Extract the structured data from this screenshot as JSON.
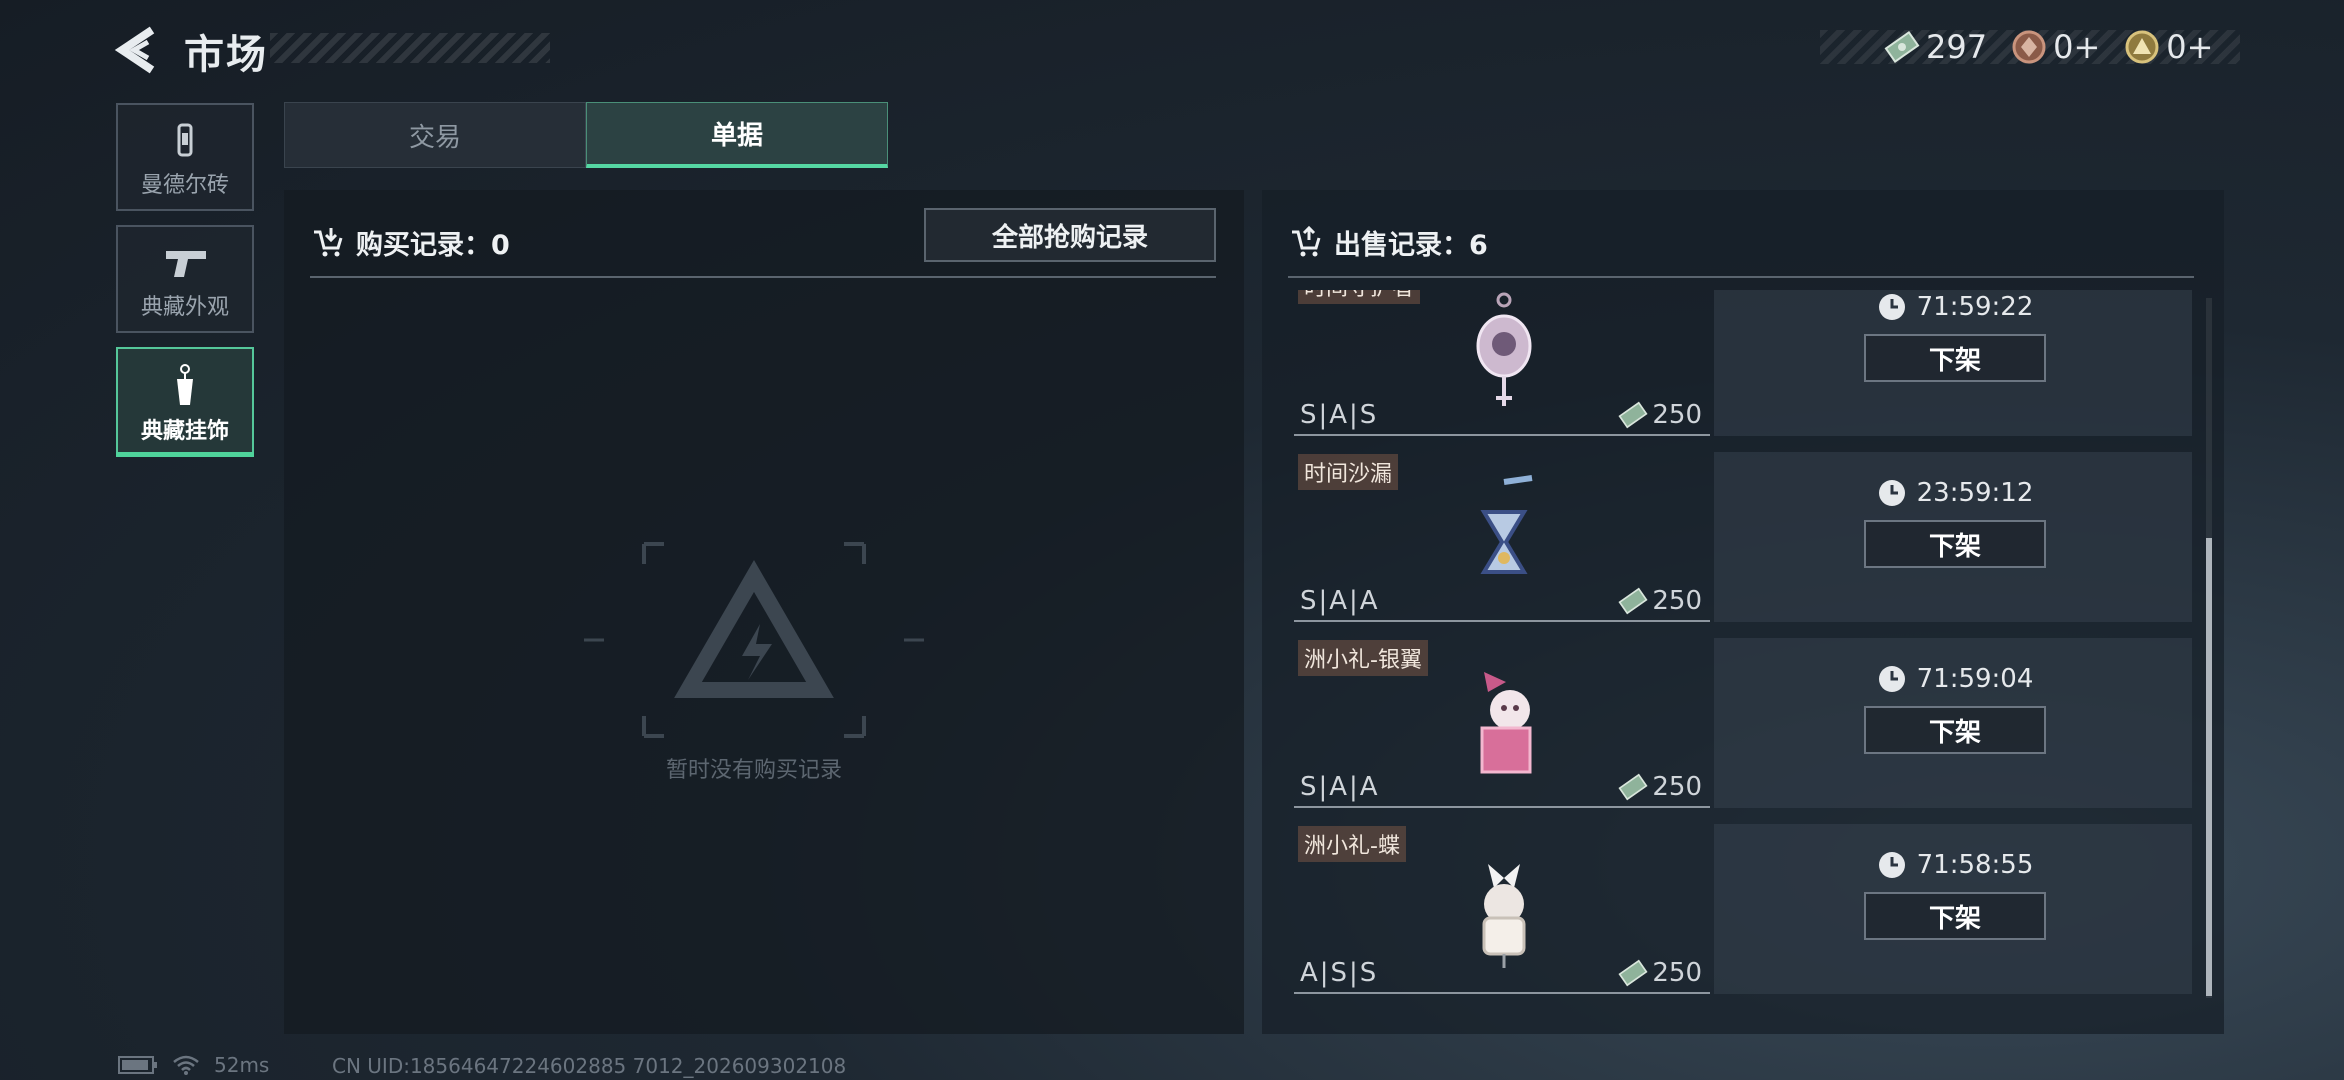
{
  "header": {
    "title": "市场",
    "currencies": [
      {
        "icon": "banknote-icon",
        "value": "297"
      },
      {
        "icon": "bronze-coin-icon",
        "value": "0+"
      },
      {
        "icon": "gold-coin-icon",
        "value": "0+"
      }
    ]
  },
  "sidebar": {
    "items": [
      {
        "label": "曼德尔砖",
        "icon": "brick-icon",
        "active": false
      },
      {
        "label": "典藏外观",
        "icon": "pistol-icon",
        "active": false
      },
      {
        "label": "典藏挂饰",
        "icon": "charm-icon",
        "active": true
      }
    ]
  },
  "tabs": [
    {
      "label": "交易",
      "active": false
    },
    {
      "label": "单据",
      "active": true
    }
  ],
  "purchase": {
    "title": "购买记录：0",
    "all_records_button": "全部抢购记录",
    "empty_text": "暂时没有购买记录"
  },
  "sales": {
    "title": "出售记录：6",
    "items": [
      {
        "name": "时间守护者",
        "grade": "S|A|S",
        "price": "250",
        "timer": "71:59:22",
        "action": "下架"
      },
      {
        "name": "时间沙漏",
        "grade": "S|A|A",
        "price": "250",
        "timer": "23:59:12",
        "action": "下架"
      },
      {
        "name": "洲小礼-银翼",
        "grade": "S|A|A",
        "price": "250",
        "timer": "71:59:04",
        "action": "下架"
      },
      {
        "name": "洲小礼-蝶",
        "grade": "A|S|S",
        "price": "250",
        "timer": "71:58:55",
        "action": "下架"
      }
    ]
  },
  "footer": {
    "ping": "52ms",
    "uid": "CN UID:18564647224602885 7012_202609302108"
  },
  "colors": {
    "accent": "#55d7a3",
    "name_tag": "#785546"
  }
}
